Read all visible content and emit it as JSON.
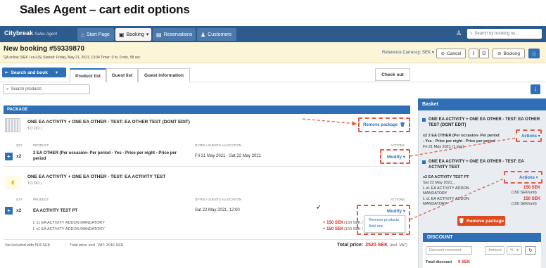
{
  "slide_title": "Sales Agent – cart edit options",
  "app": {
    "logo": "Citybreak",
    "logo_sub": "Sales Agent",
    "nav": [
      {
        "label": "Start Page",
        "icon": "home-icon"
      },
      {
        "label": "Booking",
        "icon": "briefcase-icon"
      },
      {
        "label": "Reservations",
        "icon": "book-icon"
      },
      {
        "label": "Customers",
        "icon": "users-icon"
      }
    ],
    "search_placeholder": "Search by booking nu..."
  },
  "booking": {
    "title": "New booking #59339870",
    "meta": "QA online (SEK / en-US) Started: Friday, May 21, 2021, 13:34  Timer: 0 hr, 0 min, 58 sec",
    "reference_currency": "Reference Currency: SEK ▾",
    "cancel_label": "Cancel",
    "booking_label": "Booking"
  },
  "tabs": {
    "search_and_book": "Search and book",
    "items": [
      "Product list",
      "Guest list",
      "Guest information"
    ],
    "checkout": "Check out",
    "search_products_placeholder": "Search products"
  },
  "package": {
    "header": "PACKAGE",
    "remove_package": "Remove package",
    "group1": {
      "title": "ONE EA ACTIVITY + ONE EA OTHER - TEST: EA OTHER TEST (DONT EDIT)",
      "subtitle": "TO DO |",
      "col_qty": "QTY",
      "col_product": "PRODUCT",
      "col_dates": "DATES / GUESTS ALLOCATION",
      "col_actions": "ACTIONS",
      "qty": "x2",
      "product": "2 EA OTHER (Per occasion- Per period - Yes - Price per night - Price per period",
      "dates": "Fri 21 May 2021 - Sat 22 May 2021",
      "action": "Modify ▾"
    },
    "group2": {
      "title": "ONE EA ACTIVITY + ONE EA OTHER - TEST: EA ACTIVITY TEST",
      "subtitle": "TO DO |",
      "col_qty": "QTY",
      "col_product": "PRODUCT",
      "col_dates": "DATES / GUESTS ALLOCATION",
      "col_actions": "ACTIONS",
      "qty": "x2",
      "product": "EA ACTIVITY TEST PT",
      "dates": "Sat 22 May 2021, 12:00",
      "action": "Modify ▾",
      "addon1": "L x1 EA ACTIVITY ADDON MANDATORY",
      "addon2": "L x1 EA ACTIVITY ADDON MANDATORY",
      "addon1_price": "+ 150 SEK",
      "addon2_price": "+ 150 SEK",
      "addon1_suffix": "(150 SEK /",
      "addon2_suffix": "(150 SEK /"
    },
    "dropdown": [
      "Remove products",
      "Add-ons"
    ],
    "vat_line": "Vat included with 504 SEK",
    "total_excl": "Total price excl. VAT: 2016 SEK",
    "total_label": "Total price:",
    "total_value": "2520 SEK",
    "total_suffix": "(incl. VAT)"
  },
  "basket": {
    "header": "Basket",
    "item1_title": "ONE EA ACTIVITY + ONE EA OTHER - TEST: EA OTHER TEST (DONT EDIT)",
    "item1_line1": "x2 2 EA OTHER (Per occasion- Per period",
    "item1_line2": "- Yes - Price per night - Price per period",
    "item1_line3": "Fri 21 May 2021 (1 day)",
    "item2_title": "ONE EA ACTIVITY + ONE EA OTHER - TEST: EA ACTIVITY TEST",
    "item2_line1": "x2 EA ACTIVITY TEST PT",
    "item2_line2": "Sat 22 May 2021, ,",
    "item2_line3": "L x1 EA ACTIVITY ADDON",
    "item2_line4": "MANDATORY",
    "item2_line5": "L x1 EA ACTIVITY ADDON",
    "item2_line6": "MANDATORY",
    "price1": "150 SEK",
    "price1_sub": "(150 SEK/unit)",
    "price2": "150 SEK",
    "price2_sub": "(150 SEK/unit)",
    "actions_label": "Actions ▾",
    "remove_package": "Remove package",
    "discount_header": "DISCOUNT",
    "discount_comment_placeholder": "Discount comment",
    "amount_placeholder": "Amount",
    "percent": "%",
    "total_discount_label": "Total discount",
    "total_discount_value": "0 SEK"
  },
  "colors": {
    "nav": "#2e5b8d",
    "accent": "#2e6fb6",
    "danger": "#e04a1f",
    "highlight": "#e35b45"
  }
}
